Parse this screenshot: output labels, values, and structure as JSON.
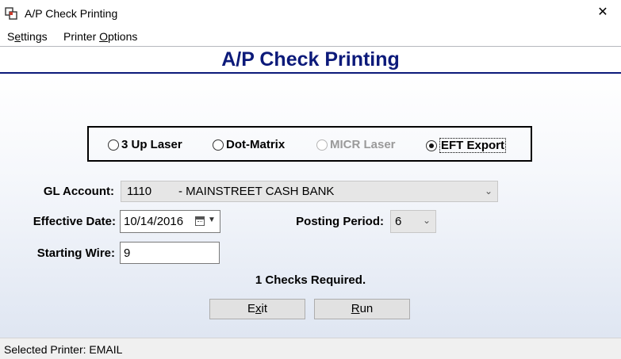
{
  "window": {
    "title": "A/P Check Printing",
    "close_glyph": "✕"
  },
  "menu": {
    "settings": {
      "pre": "S",
      "u": "e",
      "post": "ttings"
    },
    "printer_options": {
      "pre": "Printer ",
      "u": "O",
      "post": "ptions"
    }
  },
  "header": {
    "title": "A/P Check Printing"
  },
  "print_format": {
    "options": [
      {
        "label": "3 Up Laser",
        "checked": false,
        "enabled": true
      },
      {
        "label": "Dot-Matrix",
        "checked": false,
        "enabled": true
      },
      {
        "label": "MICR Laser",
        "checked": false,
        "enabled": false
      },
      {
        "label": "EFT Export",
        "checked": true,
        "enabled": true
      }
    ]
  },
  "form": {
    "gl_account_label": "GL Account:",
    "gl_account_code": "1110",
    "gl_account_name": "- MAINSTREET CASH BANK",
    "effective_date_label": "Effective Date:",
    "effective_date": "10/14/2016",
    "posting_period_label": "Posting Period:",
    "posting_period": "6",
    "starting_wire_label": "Starting Wire:",
    "starting_wire": "9"
  },
  "summary": {
    "checks_required": "1 Checks Required."
  },
  "buttons": {
    "exit": {
      "pre": "E",
      "u": "x",
      "post": "it"
    },
    "run": {
      "pre": "",
      "u": "R",
      "post": "un"
    }
  },
  "status": {
    "text": "Selected Printer: EMAIL"
  },
  "colors": {
    "title_blue": "#0c1a7a"
  }
}
